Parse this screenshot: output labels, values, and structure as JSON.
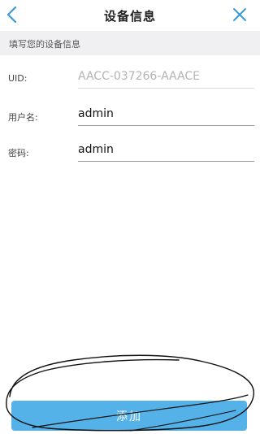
{
  "header": {
    "title": "设备信息",
    "back_icon": "chevron-left-icon",
    "close_icon": "close-icon"
  },
  "section": {
    "title": "填写您的设备信息"
  },
  "fields": {
    "uid": {
      "label": "UID:",
      "value": "AACC-037266-AAACE"
    },
    "username": {
      "label": "用户名:",
      "value": "admin"
    },
    "password": {
      "label": "密码:",
      "value": "admin"
    }
  },
  "actions": {
    "add_label": "添加"
  },
  "colors": {
    "accent": "#3a9ad9",
    "button": "#55b2e8",
    "section_bg": "#f0f0f2"
  }
}
